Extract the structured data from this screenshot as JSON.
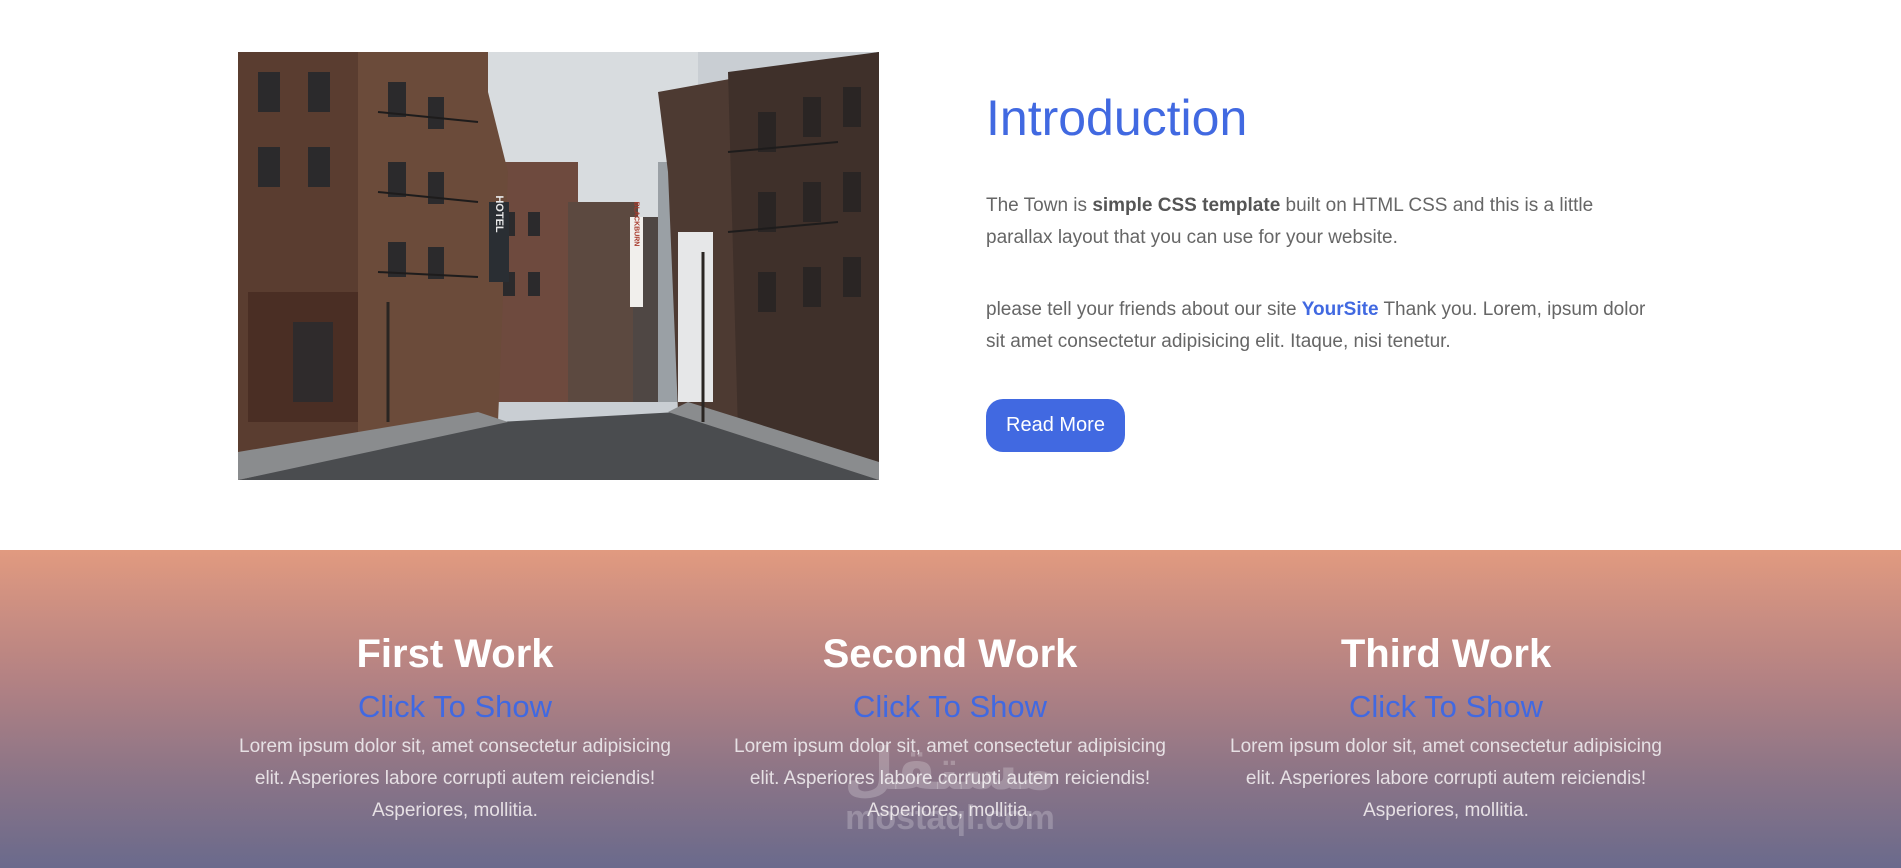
{
  "intro": {
    "image_alt": "Empty town street with brick buildings and a HOTEL sign",
    "hotel_sign": "HOTEL",
    "blackburn_sign": "BLACKBURN",
    "title": "Introduction",
    "p1_pre": "The Town is ",
    "p1_bold": "simple CSS template",
    "p1_post": " built on HTML CSS and this is a little parallax layout that you can use for your website.",
    "p2_pre": "please tell your friends about our site ",
    "p2_site": "YourSite",
    "p2_post": " Thank you. Lorem, ipsum dolor sit amet consectetur adipisicing elit. Itaque, nisi tenetur.",
    "button": "Read More"
  },
  "works": [
    {
      "title": "First Work",
      "link": "Click To Show",
      "desc": "Lorem ipsum dolor sit, amet consectetur adipisicing elit. Asperiores labore corrupti autem reiciendis! Asperiores, mollitia."
    },
    {
      "title": "Second Work",
      "link": "Click To Show",
      "desc": "Lorem ipsum dolor sit, amet consectetur adipisicing elit. Asperiores labore corrupti autem reiciendis! Asperiores, mollitia."
    },
    {
      "title": "Third Work",
      "link": "Click To Show",
      "desc": "Lorem ipsum dolor sit, amet consectetur adipisicing elit. Asperiores labore corrupti autem reiciendis! Asperiores, mollitia."
    }
  ],
  "watermark": {
    "arabic": "مستقل",
    "latin": "mostaql.com"
  },
  "colors": {
    "accent": "#4169e1",
    "gradient_top": "#e19a80",
    "gradient_bottom": "#6a6a8c",
    "body_text": "#666666"
  }
}
